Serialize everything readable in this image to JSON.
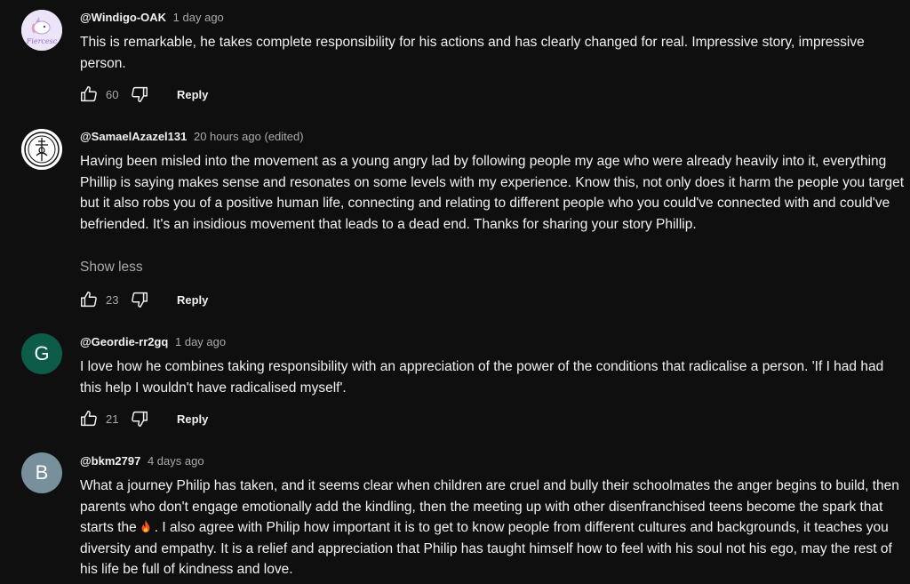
{
  "comments": [
    {
      "author": "@Windigo-OAK",
      "time": "1 day ago",
      "text": "This is remarkable,  he takes complete responsibility for his actions and has clearly changed for real. Impressive story, impressive person.",
      "likes": "60",
      "reply": "Reply",
      "avatar_text": "Fiercesc"
    },
    {
      "author": "@SamaelAzazel131",
      "time": "20 hours ago (edited)",
      "text": "Having been misled into the movement as a young angry lad by following people my age who were already heavily into it, everything Phillip is saying makes sense and resonates on some levels with my experience. Know this, not only does it harm the people you target but it also robs you of a positive human life, connecting and relating to different people who you could've connected with and could've befriended. It's an insidious movement that leads to a dead end.  Thanks for sharing your story Phillip.",
      "show_less": "Show less",
      "likes": "23",
      "reply": "Reply"
    },
    {
      "author": "@Geordie-rr2gq",
      "time": "1 day ago",
      "text": "I love how he combines taking responsibility with an appreciation of the power of the conditions that radicalise a person. 'If I had had this help I wouldn't have radicalised myself'.",
      "likes": "21",
      "reply": "Reply",
      "avatar_letter": "G",
      "avatar_color": "#0d5c4a"
    },
    {
      "author": "@bkm2797",
      "time": "4 days ago",
      "text_before": "What a journey Philip has taken, and it seems clear when children are cruel and bully their schoolmates the anger begins to build, then parents who don't engage emotionally add the kindling, then the meeting up with other disenfranchised teens become the spark that starts the",
      "text_after": ". I also agree with Philip how important it is to get to know people from different cultures and backgrounds, it teaches you diversity and empathy. It is a relief and appreciation that Philip has taught himself how to feel with his soul not his ego, may the rest of his life be full of kindness and love.",
      "emoji_icon": "fire-icon",
      "avatar_letter": "B",
      "avatar_color": "#78909c"
    }
  ]
}
